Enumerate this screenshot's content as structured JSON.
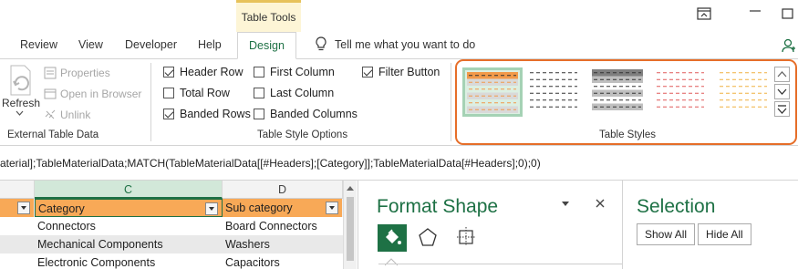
{
  "contextual_tab": "Table Tools",
  "tabs": [
    {
      "label": "Review"
    },
    {
      "label": "View"
    },
    {
      "label": "Developer"
    },
    {
      "label": "Help"
    },
    {
      "label": "Design",
      "active": true
    }
  ],
  "tell_me": "Tell me what you want to do",
  "ribbon": {
    "external": {
      "refresh": "Refresh",
      "properties": "Properties",
      "open_in_browser": "Open in Browser",
      "unlink": "Unlink",
      "label": "External Table Data"
    },
    "options": {
      "header_row": {
        "label": "Header Row",
        "checked": true
      },
      "total_row": {
        "label": "Total Row",
        "checked": false
      },
      "banded_rows": {
        "label": "Banded Rows",
        "checked": true
      },
      "first_column": {
        "label": "First Column",
        "checked": false
      },
      "last_column": {
        "label": "Last Column",
        "checked": false
      },
      "banded_columns": {
        "label": "Banded Columns",
        "checked": false
      },
      "filter_button": {
        "label": "Filter Button",
        "checked": true
      },
      "label": "Table Style Options"
    },
    "styles": {
      "label": "Table Styles",
      "swatches": [
        {
          "name": "orange-selected",
          "header": "#f29a4a",
          "band": "#d9d9d9",
          "line": "#f29a4a"
        },
        {
          "name": "plain-dashed",
          "header": "#ffffff",
          "band": "#ffffff",
          "line": "#333333"
        },
        {
          "name": "gray",
          "header": "#7f7f7f",
          "band": "#bfbfbf",
          "line": "#333333"
        },
        {
          "name": "red",
          "header": "#ffffff",
          "band": "#ffffff",
          "line": "#e05a5a"
        },
        {
          "name": "gold",
          "header": "#ffffff",
          "band": "#ffffff",
          "line": "#f0b040"
        }
      ]
    }
  },
  "formula": "aterial];TableMaterialData;MATCH(TableMaterialData[[#Headers];[Category]];TableMaterialData[#Headers];0);0)",
  "sheet": {
    "columns": [
      "C",
      "D"
    ],
    "headers": [
      "Category",
      "Sub category"
    ],
    "rows": [
      [
        "Connectors",
        "Board Connectors"
      ],
      [
        "Mechanical Components",
        "Washers"
      ],
      [
        "Electronic Components",
        "Capacitors"
      ]
    ]
  },
  "format_shape": {
    "title": "Format Shape"
  },
  "selection": {
    "title": "Selection",
    "show_all": "Show All",
    "hide_all": "Hide All"
  },
  "colors": {
    "accent": "#1e7145",
    "highlight": "#e66e29",
    "table_header": "#f8a957"
  }
}
